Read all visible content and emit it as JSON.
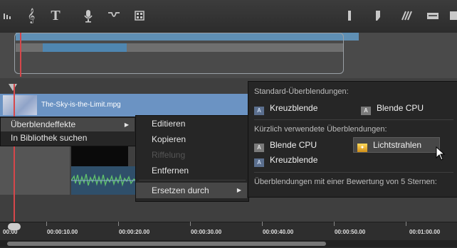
{
  "toolbar": {
    "left_icons": [
      "audio-levels-icon",
      "music-note-icon",
      "text-title-icon",
      "microphone-icon",
      "transition-icon",
      "grid-icon"
    ],
    "right_icons": [
      "marker-icon",
      "flag-icon",
      "split-icon",
      "keyboard-icon"
    ]
  },
  "clip": {
    "name": "The-Sky-is-the-Limit.mpg"
  },
  "context_menu": {
    "items": [
      {
        "label": "Überblendeffekte",
        "highlighted": true,
        "has_submenu": true
      },
      {
        "label": "In Bibliothek suchen",
        "highlighted": false,
        "has_submenu": false
      }
    ]
  },
  "submenu": {
    "items": [
      {
        "label": "Editieren",
        "disabled": false
      },
      {
        "label": "Kopieren",
        "disabled": false
      },
      {
        "label": "Riffelung",
        "disabled": true
      },
      {
        "label": "Entfernen",
        "disabled": false
      },
      {
        "label": "Ersetzen durch",
        "disabled": false,
        "has_submenu": true
      }
    ]
  },
  "transitions_panel": {
    "standard_heading": "Standard-Überblendungen:",
    "standard_items": [
      {
        "label": "Kreuzblende",
        "badge": "A"
      },
      {
        "label": "Blende CPU",
        "badge": "A"
      }
    ],
    "recent_heading": "Kürzlich verwendete Überblendungen:",
    "recent_items": [
      {
        "label": "Blende CPU",
        "badge": "A"
      },
      {
        "label": "Lichtstrahlen",
        "badge": "✦"
      },
      {
        "label": "Kreuzblende",
        "badge": "A"
      }
    ],
    "rated_heading": "Überblendungen mit einer Bewertung von 5 Sternen:"
  },
  "ruler": {
    "labels": [
      "00:00",
      "00:00:10.00",
      "00:00:20.00",
      "00:00:30.00",
      "00:00:40.00",
      "00:00:50.00",
      "00:01:00.00"
    ]
  },
  "colors": {
    "playhead": "#d6474b",
    "clip": "#6b93c3",
    "menu_bg": "#262626",
    "highlight": "#474747"
  }
}
